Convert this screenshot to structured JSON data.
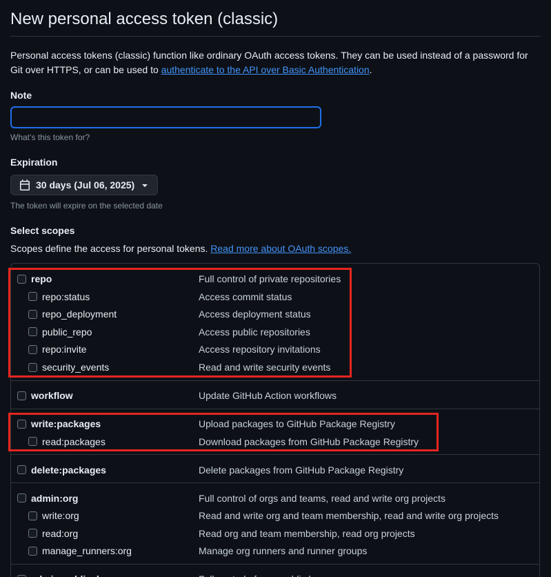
{
  "page": {
    "title": "New personal access token (classic)",
    "intro_text": "Personal access tokens (classic) function like ordinary OAuth access tokens. They can be used instead of a password for Git over HTTPS, or can be used to ",
    "intro_link": "authenticate to the API over Basic Authentication",
    "intro_end": "."
  },
  "note": {
    "label": "Note",
    "value": "",
    "hint": "What’s this token for?"
  },
  "expiration": {
    "label": "Expiration",
    "selected": "30 days (Jul 06, 2025)",
    "hint": "The token will expire on the selected date",
    "icons": [
      "calendar-icon",
      "caret-down-icon"
    ]
  },
  "scopes": {
    "label": "Select scopes",
    "description": "Scopes define the access for personal tokens. ",
    "description_link": "Read more about OAuth scopes.",
    "groups": [
      {
        "items": [
          {
            "name": "repo",
            "desc": "Full control of private repositories",
            "level": "parent"
          },
          {
            "name": "repo:status",
            "desc": "Access commit status",
            "level": "child"
          },
          {
            "name": "repo_deployment",
            "desc": "Access deployment status",
            "level": "child"
          },
          {
            "name": "public_repo",
            "desc": "Access public repositories",
            "level": "child"
          },
          {
            "name": "repo:invite",
            "desc": "Access repository invitations",
            "level": "child"
          },
          {
            "name": "security_events",
            "desc": "Read and write security events",
            "level": "child"
          }
        ]
      },
      {
        "items": [
          {
            "name": "workflow",
            "desc": "Update GitHub Action workflows",
            "level": "parent"
          }
        ]
      },
      {
        "items": [
          {
            "name": "write:packages",
            "desc": "Upload packages to GitHub Package Registry",
            "level": "parent"
          },
          {
            "name": "read:packages",
            "desc": "Download packages from GitHub Package Registry",
            "level": "child"
          }
        ]
      },
      {
        "items": [
          {
            "name": "delete:packages",
            "desc": "Delete packages from GitHub Package Registry",
            "level": "parent"
          }
        ]
      },
      {
        "items": [
          {
            "name": "admin:org",
            "desc": "Full control of orgs and teams, read and write org projects",
            "level": "parent"
          },
          {
            "name": "write:org",
            "desc": "Read and write org and team membership, read and write org projects",
            "level": "child"
          },
          {
            "name": "read:org",
            "desc": "Read org and team membership, read org projects",
            "level": "child"
          },
          {
            "name": "manage_runners:org",
            "desc": "Manage org runners and runner groups",
            "level": "child"
          }
        ]
      },
      {
        "items": [
          {
            "name": "admin:public_key",
            "desc": "Full control of user public keys",
            "level": "parent"
          }
        ]
      }
    ]
  },
  "colors": {
    "background": "#0d1117",
    "link": "#4493f8",
    "focus_border": "#1f6feb",
    "highlight_annotation": "#e5251f"
  }
}
